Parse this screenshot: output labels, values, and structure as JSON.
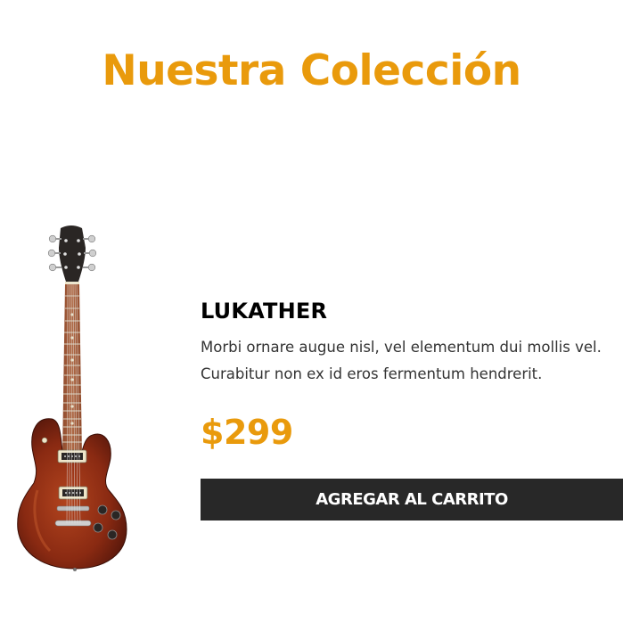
{
  "header": {
    "title": "Nuestra Colección"
  },
  "product": {
    "name": "LUKATHER",
    "description_lines": [
      "Morbi ornare augue nisl, vel elementum dui mollis vel.",
      "Curabitur non ex id eros fermentum hendrerit."
    ],
    "price": "$299",
    "add_to_cart_label": "AGREGAR AL CARRITO",
    "image_icon": "electric-guitar"
  },
  "colors": {
    "accent": "#e99a0c",
    "button_bg": "#282828",
    "button_text": "#ffffff",
    "guitar_body": "#8a2a12",
    "guitar_neck": "#a55a3a"
  }
}
